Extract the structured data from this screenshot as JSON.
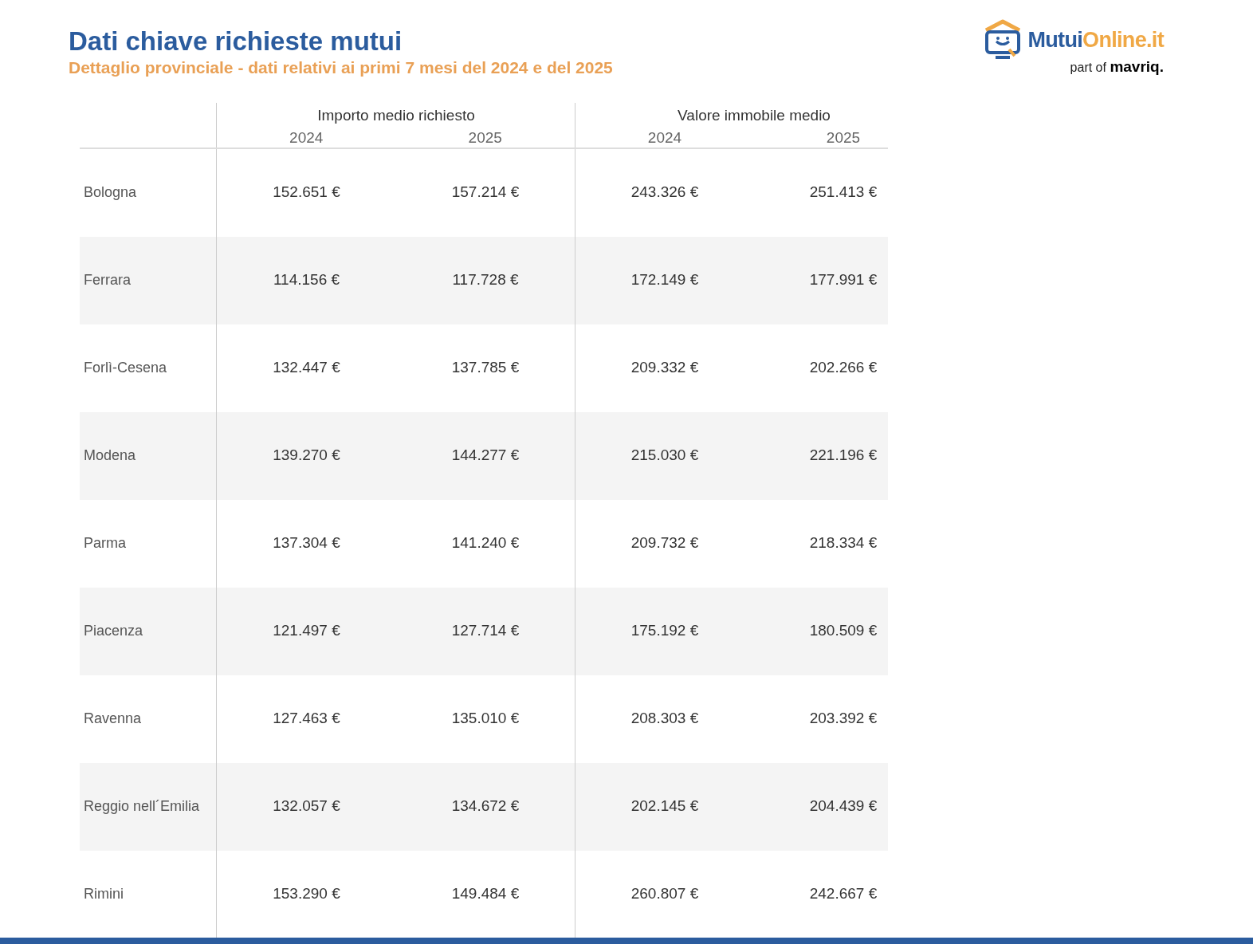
{
  "header": {
    "title": "Dati chiave richieste mutui",
    "subtitle": "Dettaglio provinciale - dati relativi ai primi 7 mesi del 2024 e del 2025"
  },
  "logo": {
    "brand_primary": "Mutui",
    "brand_secondary": "Online.it",
    "tagline_prefix": "part of",
    "tagline_brand": "mavriq."
  },
  "table": {
    "groups": [
      {
        "label": "Importo medio richiesto",
        "years": [
          "2024",
          "2025"
        ]
      },
      {
        "label": "Valore immobile medio",
        "years": [
          "2024",
          "2025"
        ]
      }
    ],
    "rows": [
      {
        "name": "Bologna",
        "values": [
          "152.651 €",
          "157.214 €",
          "243.326 €",
          "251.413 €"
        ]
      },
      {
        "name": "Ferrara",
        "values": [
          "114.156 €",
          "117.728 €",
          "172.149 €",
          "177.991 €"
        ]
      },
      {
        "name": "Forlì-Cesena",
        "values": [
          "132.447 €",
          "137.785 €",
          "209.332 €",
          "202.266 €"
        ]
      },
      {
        "name": "Modena",
        "values": [
          "139.270 €",
          "144.277 €",
          "215.030 €",
          "221.196 €"
        ]
      },
      {
        "name": "Parma",
        "values": [
          "137.304 €",
          "141.240 €",
          "209.732 €",
          "218.334 €"
        ]
      },
      {
        "name": "Piacenza",
        "values": [
          "121.497 €",
          "127.714 €",
          "175.192 €",
          "180.509 €"
        ]
      },
      {
        "name": "Ravenna",
        "values": [
          "127.463 €",
          "135.010 €",
          "208.303 €",
          "203.392 €"
        ]
      },
      {
        "name": "Reggio nell´Emilia",
        "values": [
          "132.057 €",
          "134.672 €",
          "202.145 €",
          "204.439 €"
        ]
      },
      {
        "name": "Rimini",
        "values": [
          "153.290 €",
          "149.484 €",
          "260.807 €",
          "242.667 €"
        ]
      }
    ]
  }
}
